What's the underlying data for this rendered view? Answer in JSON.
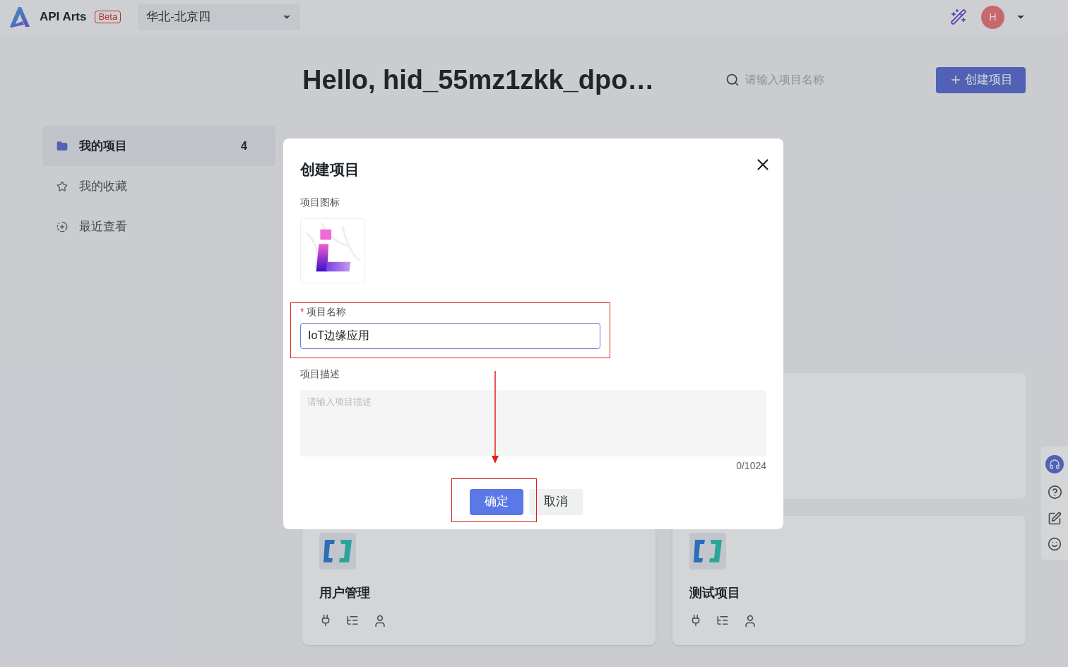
{
  "header": {
    "app_name": "API Arts",
    "badge": "Beta",
    "region": "华北-北京四",
    "avatar": "H"
  },
  "sidebar": {
    "items": [
      {
        "label": "我的项目",
        "count": "4",
        "selected": true
      },
      {
        "label": "我的收藏",
        "selected": false
      },
      {
        "label": "最近查看",
        "selected": false
      }
    ]
  },
  "main": {
    "greeting": "Hello, hid_55mz1zkk_dpo…",
    "search": {
      "placeholder": "请输入项目名称"
    },
    "create_button": "创建项目",
    "projects": [
      {
        "name": "用户管理"
      },
      {
        "name": "测试项目"
      }
    ]
  },
  "dialog": {
    "title": "创建项目",
    "icon_label": "项目图标",
    "name_field": {
      "label": "项目名称",
      "required_mark": "*",
      "value": "IoT边缘应用"
    },
    "description_field": {
      "label": "项目描述",
      "placeholder": "请输入项目描述",
      "counter": "0/1024"
    },
    "buttons": [
      {
        "label": "确定",
        "kind": "primary"
      },
      {
        "label": "取消",
        "kind": "secondary"
      }
    ]
  }
}
